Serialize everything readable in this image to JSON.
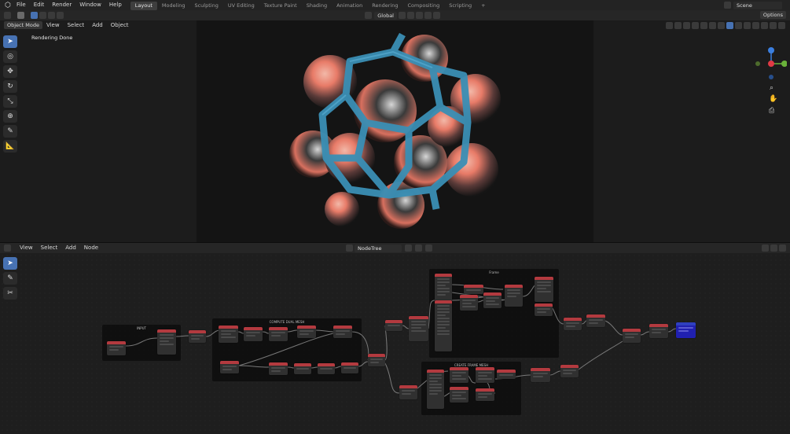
{
  "app": {
    "logo_icon": "blender-logo-icon"
  },
  "menu": [
    "File",
    "Edit",
    "Render",
    "Window",
    "Help"
  ],
  "workspaces": [
    "Layout",
    "Modeling",
    "Sculpting",
    "UV Editing",
    "Texture Paint",
    "Shading",
    "Animation",
    "Rendering",
    "Compositing",
    "Scripting"
  ],
  "active_workspace": "Layout",
  "scene": {
    "name": "Scene"
  },
  "viewport_header": {
    "transform_orientation": "Global",
    "options_label": "Options"
  },
  "viewport_subheader": {
    "mode": "Object Mode",
    "menu": [
      "View",
      "Select",
      "Add",
      "Object"
    ]
  },
  "viewport": {
    "status": "Rendering Done",
    "gizmo_colors": {
      "x": "#e03a45",
      "y": "#6ab23a",
      "z": "#3b7fe0"
    }
  },
  "node_header": {
    "menu": [
      "View",
      "Select",
      "Add",
      "Node"
    ],
    "tree_name": "NodeTree"
  },
  "frames": {
    "input": "INPUT",
    "compute": "COMPUTE DUAL MESH",
    "frame": "Frame",
    "create": "CREATE FRAME MESH"
  },
  "colors": {
    "accent": "#4772b3",
    "node_header": "#b33a3f",
    "output_node": "#2020b0",
    "object_blue": "#3a8fb5",
    "object_salmon": "#e87b68"
  }
}
